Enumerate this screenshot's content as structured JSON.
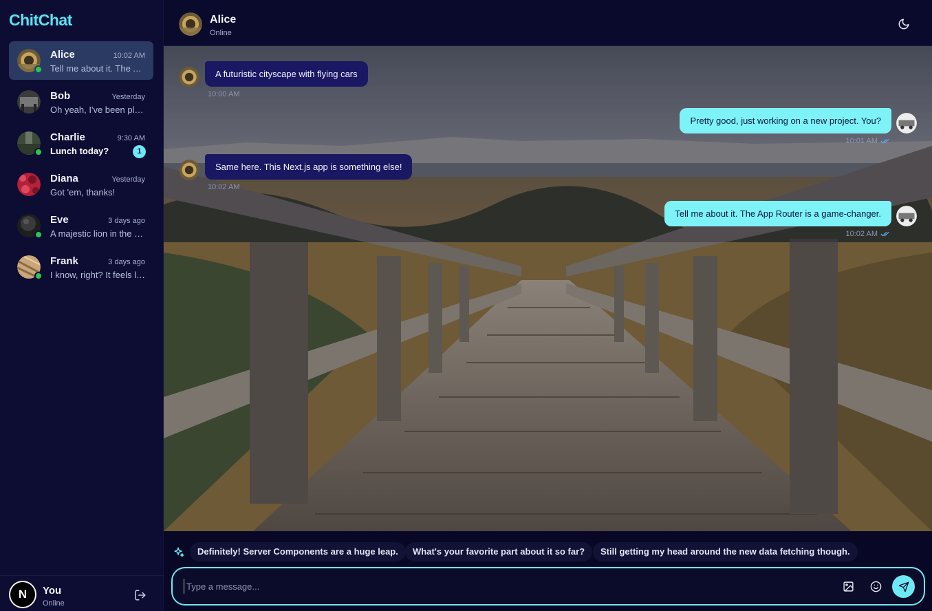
{
  "app": {
    "brand": "ChitChat"
  },
  "sidebar": {
    "chats": [
      {
        "name": "Alice",
        "time": "10:02 AM",
        "preview": "Tell me about it. The App Router is a game-changer.",
        "online": true,
        "active": true,
        "unread": "",
        "avatar": "alice-avatar"
      },
      {
        "name": "Bob",
        "time": "Yesterday",
        "preview": "Oh yeah, I've been playing with it all week.",
        "online": false,
        "active": false,
        "unread": "",
        "avatar": "bob-avatar"
      },
      {
        "name": "Charlie",
        "time": "9:30 AM",
        "preview": "Lunch today?",
        "online": true,
        "active": false,
        "unread": "1",
        "avatar": "charlie-avatar"
      },
      {
        "name": "Diana",
        "time": "Yesterday",
        "preview": "Got 'em, thanks!",
        "online": false,
        "active": false,
        "unread": "",
        "avatar": "diana-avatar"
      },
      {
        "name": "Eve",
        "time": "3 days ago",
        "preview": "A majestic lion in the savanna",
        "online": true,
        "active": false,
        "unread": "",
        "avatar": "eve-avatar"
      },
      {
        "name": "Frank",
        "time": "3 days ago",
        "preview": "I know, right? It feels like magic.",
        "online": true,
        "active": false,
        "unread": "",
        "avatar": "frank-avatar"
      }
    ],
    "me": {
      "initial": "N",
      "name": "You",
      "status": "Online"
    }
  },
  "header": {
    "name": "Alice",
    "status": "Online"
  },
  "messages": [
    {
      "direction": "in",
      "text": "A futuristic cityscape with flying cars",
      "time": "10:00 AM"
    },
    {
      "direction": "out",
      "text": "Pretty good, just working on a new project. You?",
      "time": "10:01 AM"
    },
    {
      "direction": "in",
      "text": "Same here. This Next.js app is something else!",
      "time": "10:02 AM"
    },
    {
      "direction": "out",
      "text": "Tell me about it. The App Router is a game-changer.",
      "time": "10:02 AM"
    }
  ],
  "suggestions": [
    "Definitely! Server Components are a huge leap.",
    "What's your favorite part about it so far?",
    "Still getting my head around the new data fetching though."
  ],
  "composer": {
    "placeholder": "Type a message..."
  },
  "colors": {
    "accent": "#6ee8f5",
    "brand": "#5ce1f0",
    "incoming_bubble": "#1a1863",
    "outgoing_bubble": "#7df3f8",
    "online": "#2bc651"
  }
}
